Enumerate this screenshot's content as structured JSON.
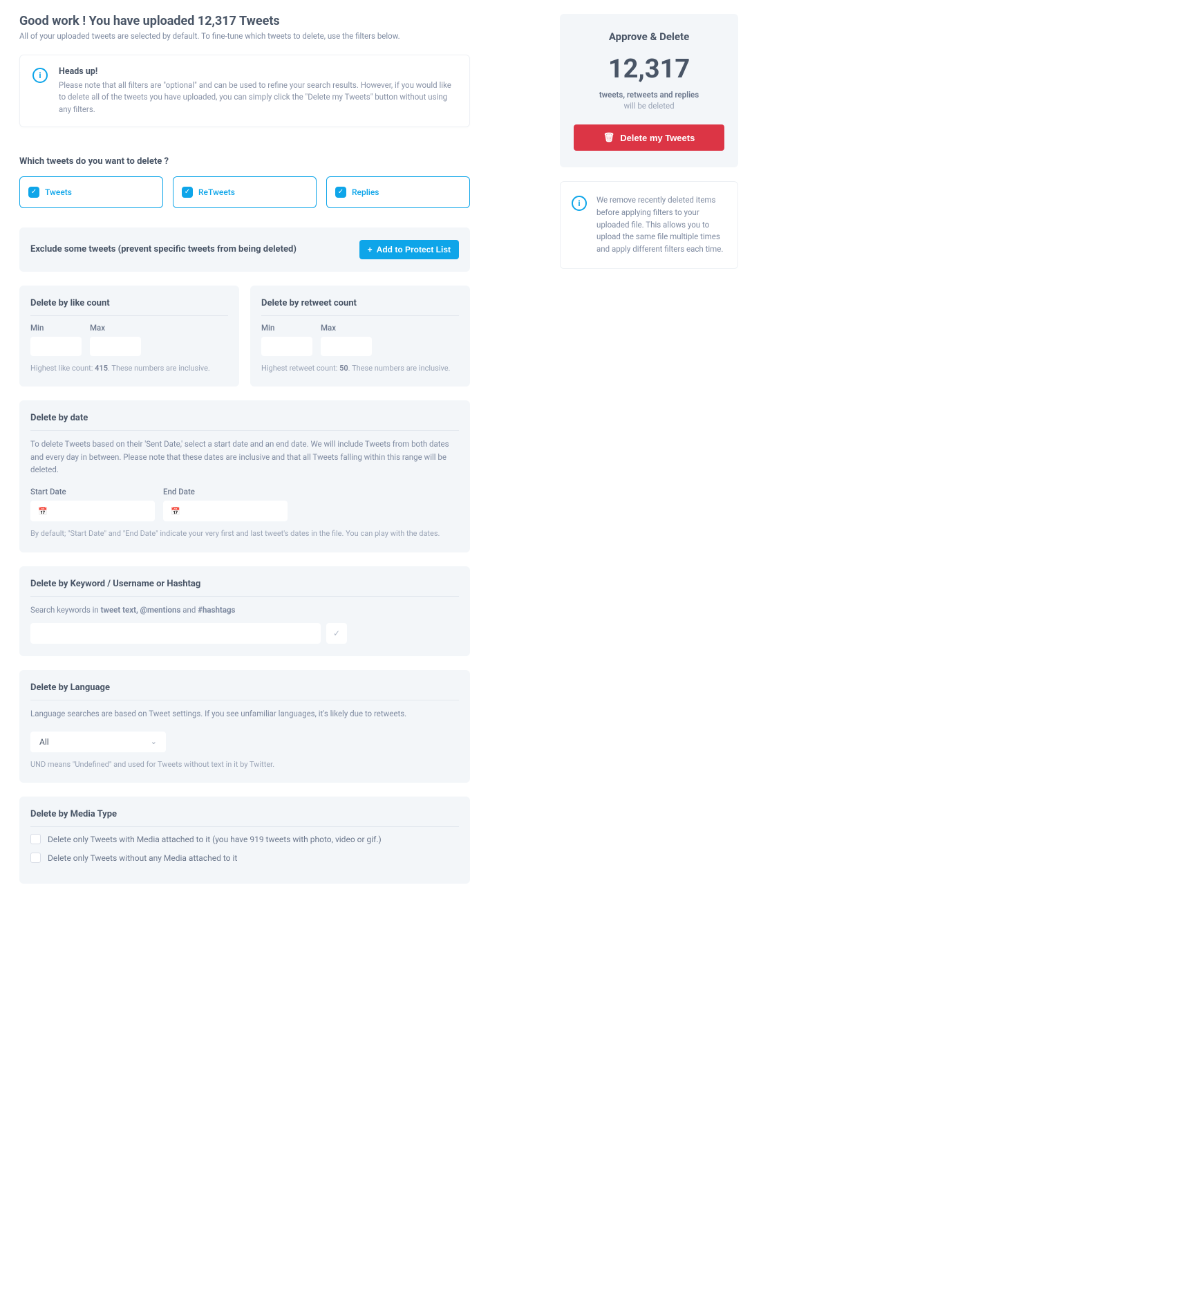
{
  "header": {
    "title": "Good work ! You have uploaded 12,317 Tweets",
    "subtitle": "All of your uploaded tweets are selected by default. To fine-tune which tweets to delete, use the filters below."
  },
  "callout": {
    "title": "Heads up!",
    "body": "Please note that all filters are \"optional\" and can be used to refine your search results. However, if you would like to delete all of the tweets you have uploaded, you can simply click the \"Delete my Tweets\" button without using any filters."
  },
  "type_section": {
    "title": "Which tweets do you want to delete ?",
    "options": [
      {
        "label": "Tweets"
      },
      {
        "label": "ReTweets"
      },
      {
        "label": "Replies"
      }
    ]
  },
  "exclude": {
    "title": "Exclude some tweets (prevent specific tweets from being deleted)",
    "button": "Add to Protect List"
  },
  "like_count": {
    "title": "Delete by like count",
    "min_label": "Min",
    "max_label": "Max",
    "hint_pre": "Highest like count: ",
    "hint_val": "415",
    "hint_post": ". These numbers are inclusive."
  },
  "retweet_count": {
    "title": "Delete by retweet count",
    "min_label": "Min",
    "max_label": "Max",
    "hint_pre": "Highest retweet count: ",
    "hint_val": "50",
    "hint_post": ". These numbers are inclusive."
  },
  "date": {
    "title": "Delete by date",
    "desc": "To delete Tweets based on their 'Sent Date,' select a start date and an end date. We will include Tweets from both dates and every day in between. Please note that these dates are inclusive and that all Tweets falling within this range will be deleted.",
    "start_label": "Start Date",
    "end_label": "End Date",
    "hint": "By default; \"Start Date\" and \"End Date\" indicate your very first and last tweet's dates in the file. You can play with the dates."
  },
  "keyword": {
    "title": "Delete by Keyword / Username or Hashtag",
    "desc_pre": "Search keywords in ",
    "desc_b1": "tweet text, @mentions",
    "desc_mid": " and ",
    "desc_b2": "#hashtags"
  },
  "language": {
    "title": "Delete by Language",
    "desc": "Language searches are based on Tweet settings. If you see unfamiliar languages, it's likely due to retweets.",
    "selected": "All",
    "hint": "UND means \"Undefined\" and used for Tweets without text in it by Twitter."
  },
  "media": {
    "title": "Delete by Media Type",
    "opt1": "Delete only Tweets with Media attached to it (you have 919 tweets with photo, video or gif.)",
    "opt2": "Delete only Tweets without any Media attached to it"
  },
  "sidebar": {
    "approve_title": "Approve & Delete",
    "count": "12,317",
    "meta1": "tweets, retweets and replies",
    "meta2": "will be deleted",
    "delete_btn": "Delete my Tweets",
    "info": "We remove recently deleted items before applying filters to your uploaded file. This allows you to upload the same file multiple times and apply different filters each time."
  }
}
